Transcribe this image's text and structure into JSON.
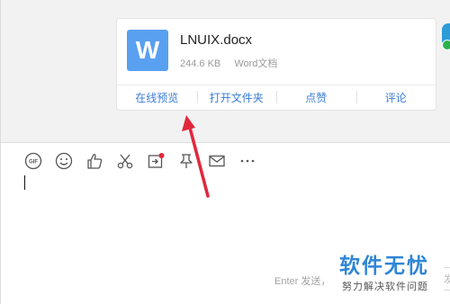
{
  "file_card": {
    "icon_letter": "W",
    "file_name": "LNUIX.docx",
    "file_size": "244.6 KB",
    "file_type": "Word文档",
    "actions": [
      "在线预览",
      "打开文件夹",
      "点赞",
      "评论"
    ]
  },
  "toolbar": {
    "icons": [
      "gif-icon",
      "emoji-icon",
      "thumbs-up-icon",
      "scissors-icon",
      "screen-share-icon",
      "pin-icon",
      "mail-icon",
      "more-icon"
    ]
  },
  "input": {
    "send_hint": "Enter 发送，",
    "send_label": "发"
  },
  "watermark": {
    "title": "软件无忧",
    "subtitle": "努力解决软件问题"
  },
  "colors": {
    "accent": "#3b7dd8",
    "word_blue": "#5aa0f0",
    "arrow_red": "#e0283c"
  }
}
